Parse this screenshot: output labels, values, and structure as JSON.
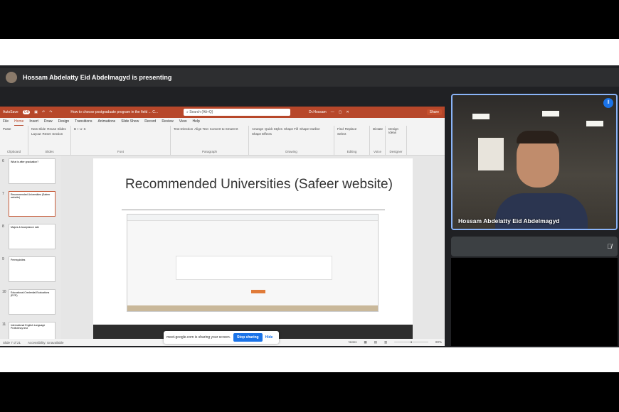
{
  "presenting_banner": "Hossam Abdelatty Eid Abdelmagyd is presenting",
  "powerpoint": {
    "autosave": "AutoSave",
    "autosave_state": "Off",
    "doc_title": "How to choose postgraduate program in the field ... C...",
    "search_placeholder": "Search (Alt+Q)",
    "user": "Dr.Hossam",
    "share": "Share",
    "tabs": [
      "File",
      "Home",
      "Insert",
      "Draw",
      "Design",
      "Transitions",
      "Animations",
      "Slide Show",
      "Record",
      "Review",
      "View",
      "Help"
    ],
    "active_tab": "Home",
    "ribbon_groups": [
      {
        "label": "Clipboard",
        "items": [
          "Paste"
        ]
      },
      {
        "label": "Slides",
        "items": [
          "New Slide",
          "Reuse Slides",
          "Layout",
          "Reset",
          "Section"
        ]
      },
      {
        "label": "Font",
        "items": [
          "B",
          "I",
          "U",
          "S"
        ]
      },
      {
        "label": "Paragraph",
        "items": [
          "Text Direction",
          "Align Text",
          "Convert to SmartArt"
        ]
      },
      {
        "label": "Drawing",
        "items": [
          "Arrange",
          "Quick Styles",
          "Shape Fill",
          "Shape Outline",
          "Shape Effects"
        ]
      },
      {
        "label": "Editing",
        "items": [
          "Find",
          "Replace",
          "Select"
        ]
      },
      {
        "label": "Voice",
        "items": [
          "Dictate"
        ]
      },
      {
        "label": "Designer",
        "items": [
          "Design Ideas"
        ]
      }
    ],
    "thumbnails": [
      {
        "num": "6",
        "text": "What is after graduation?"
      },
      {
        "num": "7",
        "text": "Recommended Universities (Safeer website)"
      },
      {
        "num": "8",
        "text": "Majors & Acceptance rate"
      },
      {
        "num": "9",
        "text": "Prerequisites"
      },
      {
        "num": "10",
        "text": "Educational Credential Evaluations (ECE)"
      },
      {
        "num": "11",
        "text": "International English Language Proficiency test"
      }
    ],
    "selected_thumbnail": "7",
    "slide_title": "Recommended Universities (Safeer website)",
    "status": {
      "slide": "Slide 7 of 21",
      "accessibility": "Accessibility: Unavailable",
      "notes": "Notes",
      "zoom": "80%"
    }
  },
  "share_notice": {
    "text": "meet.google.com is sharing your screen.",
    "stop": "Stop sharing",
    "hide": "Hide"
  },
  "participant": {
    "name": "Hossam Abdelatty Eid Abdelmagyd"
  },
  "colors": {
    "ppt_accent": "#b7472a",
    "meet_bg": "#202124",
    "meet_blue": "#1a73e8"
  }
}
